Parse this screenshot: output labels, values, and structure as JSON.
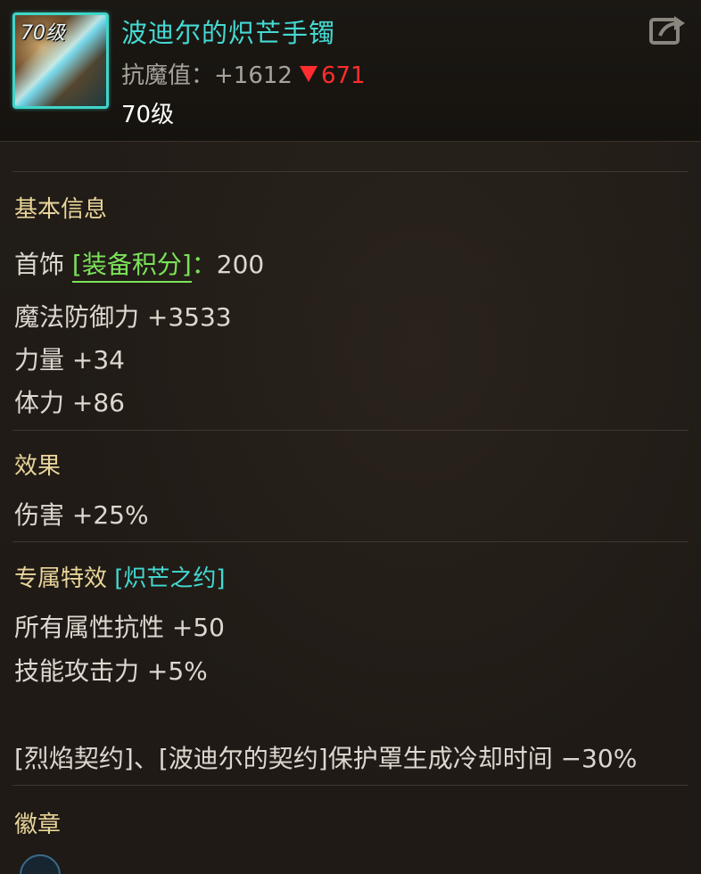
{
  "item": {
    "icon_level": "70级",
    "name": "波迪尔的炽芒手镯",
    "resist_label": "抗魔值：",
    "resist_value": "+1612",
    "resist_diff": "671",
    "level": "70级"
  },
  "basic": {
    "title": "基本信息",
    "slot": "首饰",
    "score_label": "[装备积分]",
    "score_colon": "：",
    "score_value": "200",
    "magic_def": "魔法防御力 +3533",
    "strength": "力量 +34",
    "vitality": "体力 +86"
  },
  "effect": {
    "title": "效果",
    "damage": "伤害 +25%"
  },
  "special": {
    "title": "专属特效",
    "name": "[炽芒之约]",
    "all_resist": "所有属性抗性 +50",
    "skill_atk": "技能攻击力 +5%",
    "shield_note": "[烈焰契约]、[波迪尔的契约]保护罩生成冷却时间 −30%"
  },
  "emblem": {
    "title": "徽章"
  },
  "colors": {
    "name": "#44d9d2",
    "section_title": "#e9d59a",
    "score": "#7be25a",
    "decrease": "#ff2d2d"
  }
}
